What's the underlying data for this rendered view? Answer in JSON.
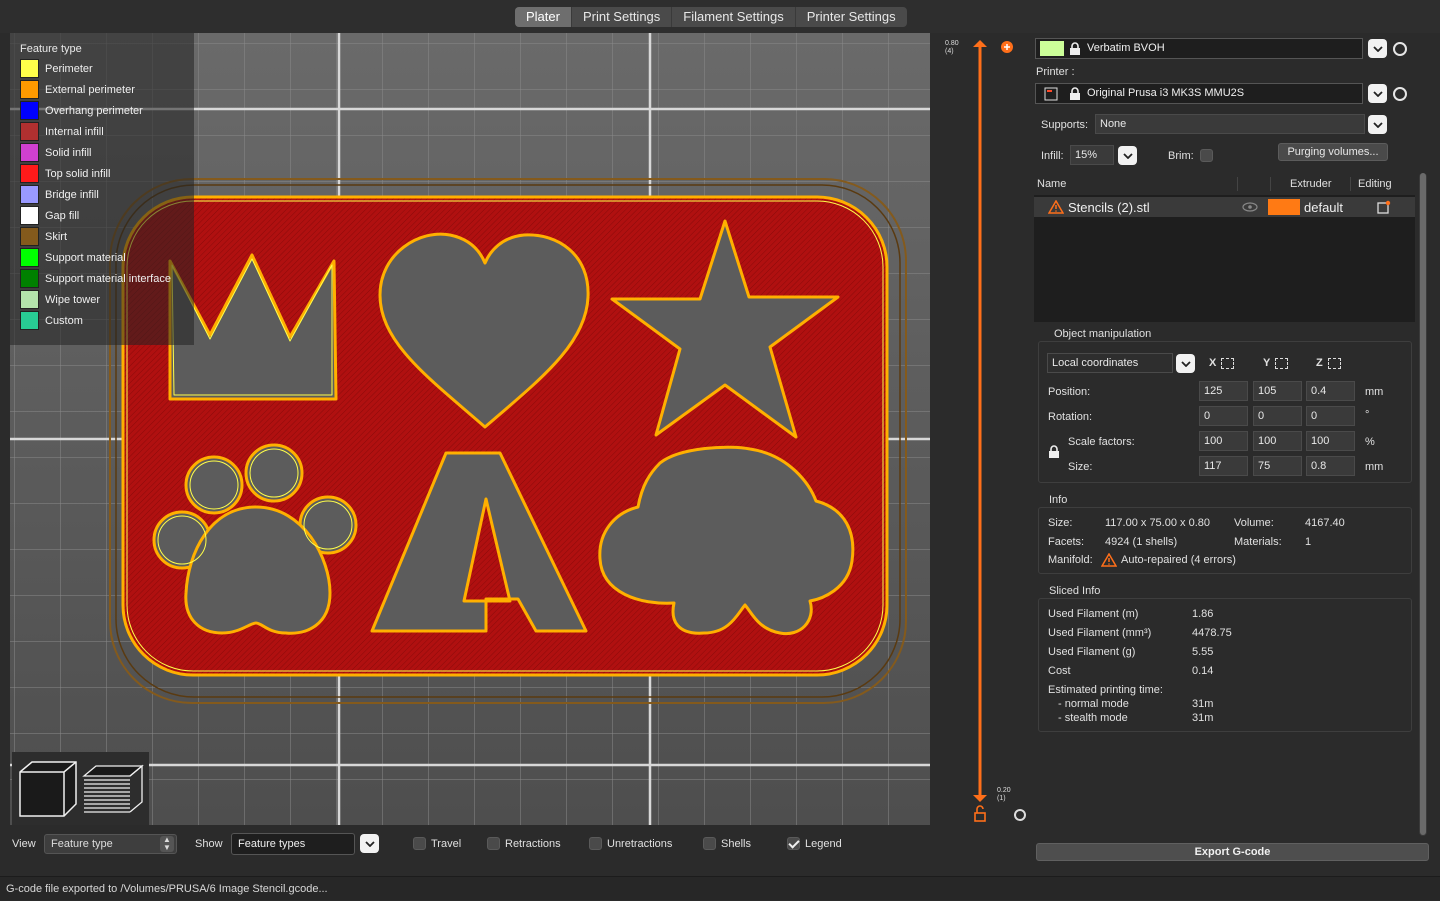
{
  "tabs": [
    "Plater",
    "Print Settings",
    "Filament Settings",
    "Printer Settings"
  ],
  "legend": {
    "title": "Feature type",
    "items": [
      {
        "label": "Perimeter",
        "color": "#ffff4a"
      },
      {
        "label": "External perimeter",
        "color": "#ff9a00"
      },
      {
        "label": "Overhang perimeter",
        "color": "#0000ff"
      },
      {
        "label": "Internal infill",
        "color": "#b03030"
      },
      {
        "label": "Solid infill",
        "color": "#d040d0"
      },
      {
        "label": "Top solid infill",
        "color": "#ff1a1a"
      },
      {
        "label": "Bridge infill",
        "color": "#9999ff"
      },
      {
        "label": "Gap fill",
        "color": "#ffffff"
      },
      {
        "label": "Skirt",
        "color": "#845a1c"
      },
      {
        "label": "Support material",
        "color": "#00ff00"
      },
      {
        "label": "Support material interface",
        "color": "#008000"
      },
      {
        "label": "Wipe tower",
        "color": "#b3e3ab"
      },
      {
        "label": "Custom",
        "color": "#28cc94"
      }
    ]
  },
  "slider": {
    "top_value": "0.80",
    "top_layer": "(4)",
    "bottom_value": "0.20",
    "bottom_layer": "(1)"
  },
  "bottom": {
    "view_label": "View",
    "view_value": "Feature type",
    "show_label": "Show",
    "show_value": "Feature types",
    "checkboxes": [
      {
        "label": "Travel",
        "checked": false
      },
      {
        "label": "Retractions",
        "checked": false
      },
      {
        "label": "Unretractions",
        "checked": false
      },
      {
        "label": "Shells",
        "checked": false
      },
      {
        "label": "Legend",
        "checked": true
      }
    ]
  },
  "status": "G-code file exported to /Volumes/PRUSA/6 Image Stencil.gcode...",
  "right": {
    "filament": "Verbatim BVOH",
    "filament_color": "#ccff99",
    "printer_label": "Printer :",
    "printer": "Original Prusa i3 MK3S MMU2S",
    "supports_label": "Supports:",
    "supports_value": "None",
    "infill_label": "Infill:",
    "infill_value": "15%",
    "brim_label": "Brim:",
    "purging_btn": "Purging volumes...",
    "list_headers": {
      "name": "Name",
      "extruder": "Extruder",
      "editing": "Editing"
    },
    "object": {
      "name": "Stencils (2).stl",
      "extruder": "default",
      "extruder_color": "#ff7a14"
    },
    "manip": {
      "title": "Object manipulation",
      "coords": "Local coordinates",
      "axes": [
        "X",
        "Y",
        "Z"
      ],
      "position_label": "Position:",
      "position": [
        "125",
        "105",
        "0.4"
      ],
      "position_unit": "mm",
      "rotation_label": "Rotation:",
      "rotation": [
        "0",
        "0",
        "0"
      ],
      "rotation_unit": "°",
      "scale_label": "Scale factors:",
      "scale": [
        "100",
        "100",
        "100"
      ],
      "scale_unit": "%",
      "size_label": "Size:",
      "size": [
        "117",
        "75",
        "0.8"
      ],
      "size_unit": "mm"
    },
    "info": {
      "title": "Info",
      "size_label": "Size:",
      "size_value": "117.00 x 75.00 x 0.80",
      "volume_label": "Volume:",
      "volume_value": "4167.40",
      "facets_label": "Facets:",
      "facets_value": "4924 (1 shells)",
      "materials_label": "Materials:",
      "materials_value": "1",
      "manifold_label": "Manifold:",
      "manifold_value": "Auto-repaired (4 errors)"
    },
    "sliced": {
      "title": "Sliced Info",
      "rows": [
        {
          "label": "Used Filament (m)",
          "value": "1.86"
        },
        {
          "label": "Used Filament (mm³)",
          "value": "4478.75"
        },
        {
          "label": "Used Filament (g)",
          "value": "5.55"
        },
        {
          "label": "Cost",
          "value": "0.14"
        }
      ],
      "time_label": "Estimated printing time:",
      "modes": [
        {
          "label": "- normal mode",
          "value": "31m"
        },
        {
          "label": "- stealth mode",
          "value": "31m"
        }
      ]
    },
    "export_btn": "Export G-code"
  }
}
